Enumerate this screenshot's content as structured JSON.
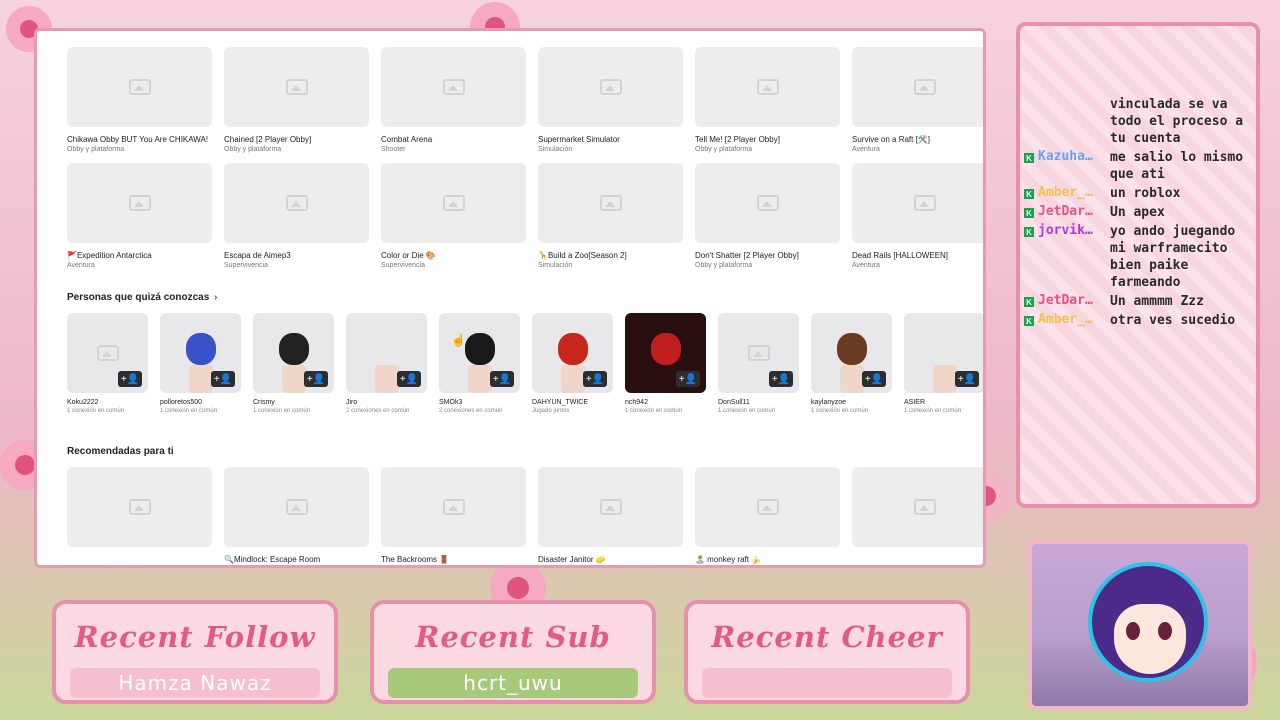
{
  "games_row1": [
    {
      "title": "Chikawa Obby BUT You Are CHIKAWA!",
      "genre": "Obby y plataforma"
    },
    {
      "title": "Chained [2 Player Obby]",
      "genre": "Obby y plataforma"
    },
    {
      "title": "Combat Arena",
      "genre": "Shooter"
    },
    {
      "title": "Supermarket Simulator",
      "genre": "Simulación"
    },
    {
      "title": "Tell Me! [2 Player Obby]",
      "genre": "Obby y plataforma"
    },
    {
      "title": "Survive on a Raft [🛠️]",
      "genre": "Aventura"
    }
  ],
  "games_row2": [
    {
      "title": "🚩Expedition Antarctica",
      "genre": "Aventura"
    },
    {
      "title": "Escapa de Aimep3",
      "genre": "Supervivencia"
    },
    {
      "title": "Color or Die 🎨",
      "genre": "Supervivencia"
    },
    {
      "title": "🦒Build a Zoo[Season 2]",
      "genre": "Simulación"
    },
    {
      "title": "Don't Shatter [2 Player Obby]",
      "genre": "Obby y plataforma"
    },
    {
      "title": "Dead Rails [HALLOWEEN]",
      "genre": "Aventura"
    }
  ],
  "people_section": {
    "title": "Personas que quizá conozcas",
    "arrow": "›"
  },
  "friends": [
    {
      "name": "Koku2222",
      "sub": "1 conexión en común"
    },
    {
      "name": "polloretos500",
      "sub": "1 conexión en común"
    },
    {
      "name": "Crismy",
      "sub": "1 conexión en común"
    },
    {
      "name": "Jiro",
      "sub": "2 conexiones en común"
    },
    {
      "name": "SMOk3",
      "sub": "2 conexiones en común"
    },
    {
      "name": "DAHYUN_TWICE",
      "sub": "Jugado juntos"
    },
    {
      "name": "nch942",
      "sub": "1 conexión en común"
    },
    {
      "name": "DonSull11",
      "sub": "1 conexión en común"
    },
    {
      "name": "kaylanyzoe",
      "sub": "1 conexión en común"
    },
    {
      "name": "ASIER",
      "sub": "1 conexión en común"
    }
  ],
  "recommended_section": {
    "title": "Recomendadas para ti"
  },
  "games_row3": [
    {
      "title": "",
      "genre": ""
    },
    {
      "title": "🔍Mindlock: Escape Room",
      "genre": ""
    },
    {
      "title": "The Backrooms 🚪",
      "genre": ""
    },
    {
      "title": "Disaster Janitor 🧽",
      "genre": ""
    },
    {
      "title": "🏝️ monkey raft 🍌",
      "genre": ""
    },
    {
      "title": "",
      "genre": ""
    }
  ],
  "chat": [
    {
      "user": "",
      "user_color": "#333333",
      "text": "vinculada se va todo el proceso a tu cuenta",
      "badge": false
    },
    {
      "user": "Kazuha…",
      "user_color": "#6aa2e8",
      "text": "me salio lo mismo que ati",
      "badge": true
    },
    {
      "user": "Amber_…",
      "user_color": "#f3c14b",
      "text": "un roblox",
      "badge": true
    },
    {
      "user": "JetDar…",
      "user_color": "#e8508a",
      "text": "Un apex",
      "badge": true
    },
    {
      "user": "jorvik…",
      "user_color": "#b03ad6",
      "text": "yo ando juegando mi warframecito bien paike farmeando",
      "badge": true
    },
    {
      "user": "JetDar…",
      "user_color": "#e8508a",
      "text": "Un ammmm Zzz",
      "badge": true
    },
    {
      "user": "Amber_…",
      "user_color": "#f3c14b",
      "text": "otra ves sucedio",
      "badge": true
    }
  ],
  "chat_badge_letter": "K",
  "widgets": {
    "follow": {
      "title": "Recent Follow",
      "value": "Hamza Nawaz"
    },
    "sub": {
      "title": "Recent Sub",
      "value": "hcrt_uwu"
    },
    "cheer": {
      "title": "Recent Cheer",
      "value": ""
    }
  },
  "add_friend_icon": "+👤",
  "colors": {
    "accent_pink": "#e35a85",
    "frame_pink": "#e88fab",
    "leaf_green": "#a9c97a"
  }
}
